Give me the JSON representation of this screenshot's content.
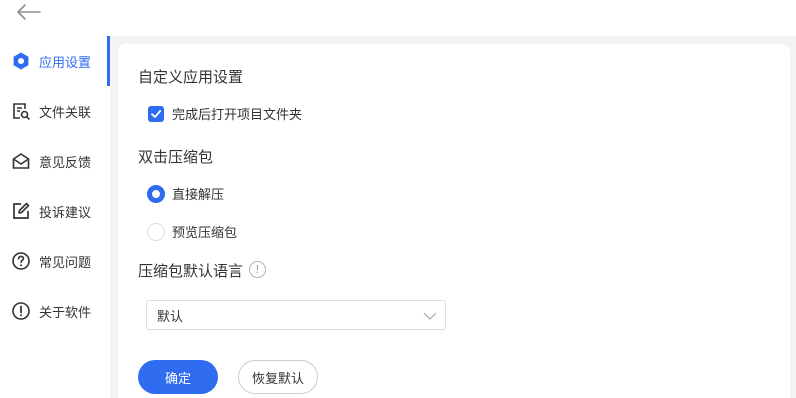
{
  "sidebar": {
    "items": [
      {
        "label": "应用设置",
        "icon": "gear-icon",
        "active": true
      },
      {
        "label": "文件关联",
        "icon": "file-link-icon"
      },
      {
        "label": "意见反馈",
        "icon": "feedback-mail-icon"
      },
      {
        "label": "投诉建议",
        "icon": "edit-icon"
      },
      {
        "label": "常见问题",
        "icon": "question-icon"
      },
      {
        "label": "关于软件",
        "icon": "info-icon"
      }
    ]
  },
  "main": {
    "custom_title": "自定义应用设置",
    "open_folder_label": "完成后打开项目文件夹",
    "open_folder_checked": true,
    "double_click_title": "双击压缩包",
    "radio_options": [
      {
        "label": "直接解压",
        "checked": true
      },
      {
        "label": "预览压缩包",
        "checked": false
      }
    ],
    "language_title": "压缩包默认语言",
    "info_glyph": "!",
    "language_select_value": "默认",
    "confirm_label": "确定",
    "restore_label": "恢复默认"
  },
  "colors": {
    "accent": "#2f6cf0",
    "background": "#f2f3f5"
  }
}
